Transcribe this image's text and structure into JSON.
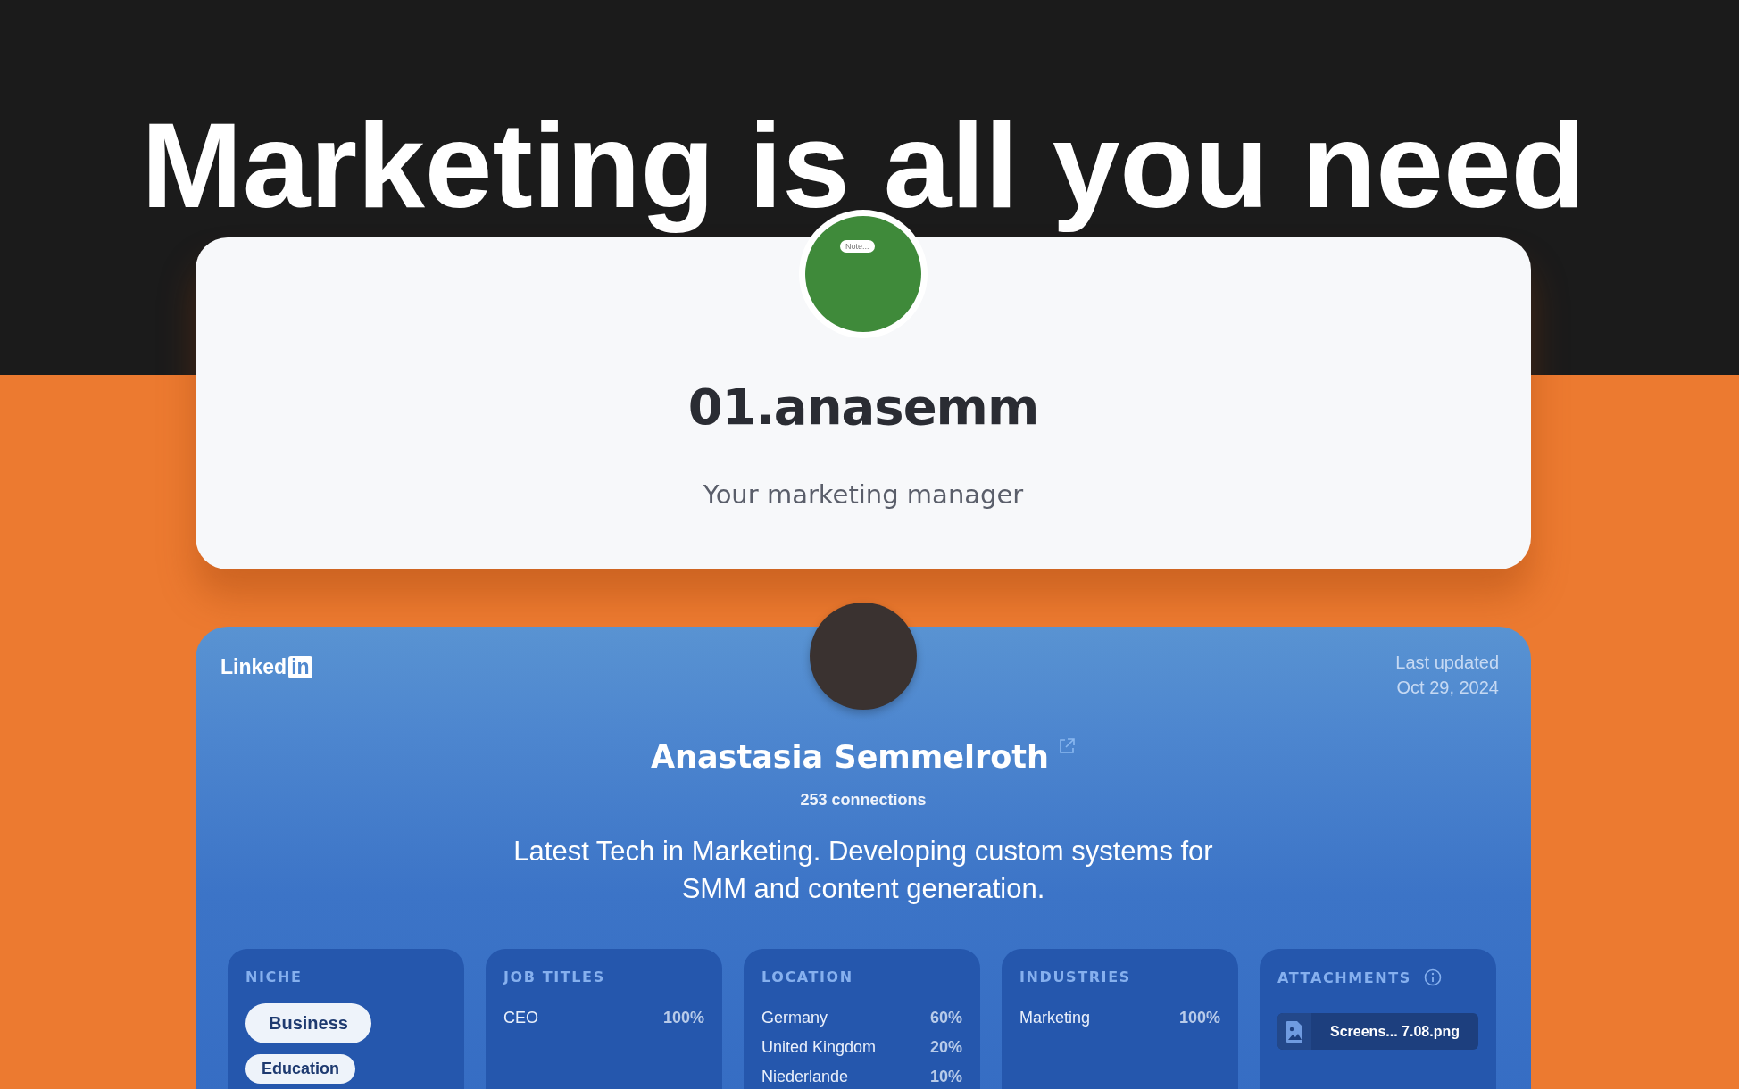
{
  "page_title": "Marketing is all you need",
  "profile": {
    "note": "Note...",
    "username": "01.anasemm",
    "tagline": "Your marketing manager"
  },
  "linkedin": {
    "brand_word": "Linked",
    "brand_badge": "in",
    "last_updated_label": "Last updated",
    "last_updated_date": "Oct 29, 2024",
    "name": "Anastasia Semmelroth",
    "connections": "253 connections",
    "headline": "Latest Tech in Marketing. Developing custom systems for SMM and content generation.",
    "sections": [
      {
        "kind": "tags",
        "title": "NICHE",
        "tags": [
          "Business",
          "Education"
        ]
      },
      {
        "kind": "stats",
        "title": "JOB TITLES",
        "rows": [
          {
            "label": "CEO",
            "value": "100%"
          }
        ]
      },
      {
        "kind": "stats",
        "title": "LOCATION",
        "rows": [
          {
            "label": "Germany",
            "value": "60%"
          },
          {
            "label": "United Kingdom",
            "value": "20%"
          },
          {
            "label": "Niederlande",
            "value": "10%"
          }
        ]
      },
      {
        "kind": "stats",
        "title": "INDUSTRIES",
        "rows": [
          {
            "label": "Marketing",
            "value": "100%"
          }
        ]
      },
      {
        "kind": "files",
        "title": "ATTACHMENTS",
        "files": [
          "Screens... 7.08.png"
        ]
      }
    ]
  }
}
